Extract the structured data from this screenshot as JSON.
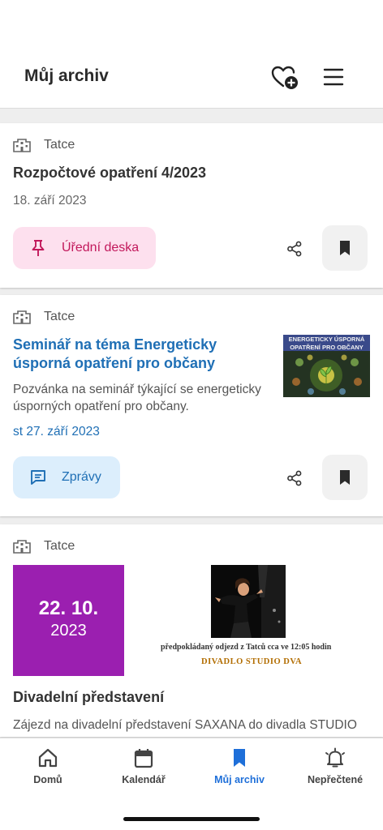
{
  "header": {
    "title": "Můj archiv",
    "fav_icon": "heart-plus-icon",
    "menu_icon": "hamburger-menu-icon"
  },
  "feed": [
    {
      "source": "Tatce",
      "title": "Rozpočtové opatření 4/2023",
      "date": "18. září 2023",
      "category": {
        "label": "Úřední deska",
        "icon": "pin-icon",
        "color": "#c2185b"
      }
    },
    {
      "source": "Tatce",
      "title": "Seminář na téma Energeticky úsporná opatření pro občany",
      "perex": "Pozvánka na seminář týkající se energeticky úsporných opatření pro občany.",
      "date": "st 27. září 2023",
      "thumbnail_title": "ENERGETICKY ÚSPORNÁ OPATŘENÍ PRO OBČANY",
      "category": {
        "label": "Zprávy",
        "icon": "message-icon",
        "color": "#1f6fb5"
      }
    },
    {
      "source": "Tatce",
      "title": "Divadelní představení",
      "perex": "Zájezd na divadelní představení SAXANA do divadla STUDIO",
      "poster": {
        "day_month": "22. 10.",
        "year": "2023",
        "departure_text": "předpokládaný odjezd z Tatců cca ve 12:05 hodin",
        "theatre": "DIVADLO STUDIO DVA"
      }
    }
  ],
  "bottom_nav": [
    {
      "label": "Domů",
      "icon": "home-icon"
    },
    {
      "label": "Kalendář",
      "icon": "calendar-icon"
    },
    {
      "label": "Můj archiv",
      "icon": "bookmark-icon",
      "active": true
    },
    {
      "label": "Nepřečtené",
      "icon": "bell-icon"
    }
  ],
  "colors": {
    "accent": "#1e6fd9",
    "link": "#1f6fb5",
    "pink_chip": "#fde0ee",
    "blue_chip": "#dceefc",
    "event_purple": "#9b1fb0"
  }
}
